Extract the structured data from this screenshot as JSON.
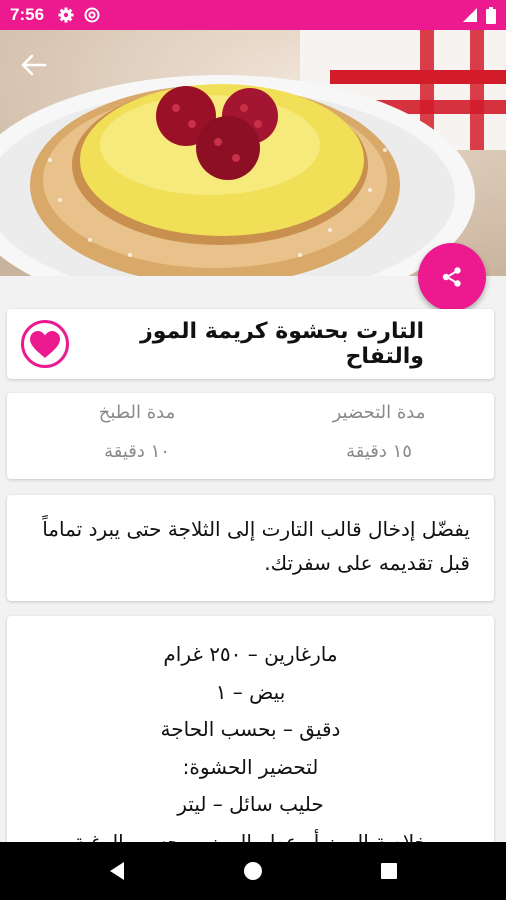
{
  "status": {
    "time": "7:56",
    "left_icons": [
      "gear-icon",
      "at-icon"
    ],
    "right_icons": [
      "signal-icon",
      "battery-icon"
    ],
    "color": "#ec1a8e"
  },
  "hero": {
    "back_icon": "arrow-left-icon"
  },
  "share": {
    "icon": "share-icon",
    "color": "#ec1a8e"
  },
  "recipe": {
    "title": "التارت بحشوة كريمة الموز والتفاح",
    "favorite_icon": "heart-icon"
  },
  "times": {
    "prep_label": "مدة التحضير",
    "prep_value": "١٥ دقيقة",
    "cook_label": "مدة الطبخ",
    "cook_value": "١٠ دقيقة"
  },
  "tip": {
    "text": "يفضّل إدخال قالب التارت إلى الثلاجة حتى يبرد تماماً قبل تقديمه على سفرتك."
  },
  "ingredients": [
    "مارغارين – ٢٥٠ غرام",
    "بيض – ١",
    "دقيق – بحسب الحاجة",
    "لتحضير الحشوة:",
    "حليب سائل – ليتر",
    "خلاصة الموز أو عطر الموز – بحسب الرغبة"
  ],
  "nav": {
    "back_icon": "triangle-back-icon",
    "home_icon": "circle-home-icon",
    "recents_icon": "square-recents-icon"
  }
}
